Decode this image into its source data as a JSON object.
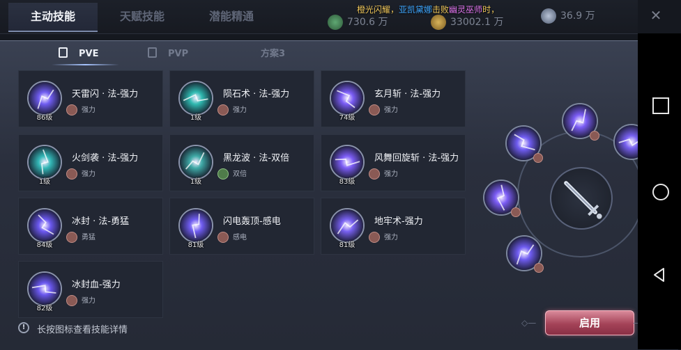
{
  "top_tabs": [
    "主动技能",
    "天赋技能",
    "潜能精通"
  ],
  "broadcast": {
    "prefix": "橙光闪耀，",
    "name1": "亚凯黛娜",
    "verb": "击败",
    "name2": "幽灵巫师",
    "suffix": "时，"
  },
  "resources": [
    {
      "icon": "jade-icon",
      "value": "730.6 万"
    },
    {
      "icon": "gold-icon",
      "value": "33002.1 万"
    },
    {
      "icon": "crystal-icon",
      "value": "36.9 万"
    }
  ],
  "sub_tabs": [
    "PVE",
    "PVP",
    "方案3"
  ],
  "skills": [
    {
      "name": "天雷闪 · 法-强力",
      "level": "86级",
      "tag": "强力",
      "tag_color": "#8a5a55",
      "icon": "lightning-skill-icon",
      "hue": "#6f5cf0"
    },
    {
      "name": "陨石术 · 法-强力",
      "level": "1级",
      "tag": "强力",
      "tag_color": "#8a5a55",
      "icon": "meteor-skill-icon",
      "hue": "#2fb9b0"
    },
    {
      "name": "玄月斩 · 法-强力",
      "level": "74级",
      "tag": "强力",
      "tag_color": "#8a5a55",
      "icon": "crescent-skill-icon",
      "hue": "#7a5cf4"
    },
    {
      "name": "火剑袭 · 法-强力",
      "level": "1级",
      "tag": "强力",
      "tag_color": "#8a5a55",
      "icon": "fire-sword-skill-icon",
      "hue": "#33b7b6"
    },
    {
      "name": "黑龙波 · 法-双倍",
      "level": "1级",
      "tag": "双倍",
      "tag_color": "#4f7c4a",
      "icon": "dragon-skill-icon",
      "hue": "#3fa9a6"
    },
    {
      "name": "风舞回旋斩 · 法-强力",
      "level": "83级",
      "tag": "强力",
      "tag_color": "#8a5a55",
      "icon": "whirlwind-skill-icon",
      "hue": "#7b5cf4"
    },
    {
      "name": "冰封 · 法-勇猛",
      "level": "84级",
      "tag": "勇猛",
      "tag_color": "#8a5a55",
      "icon": "ice-seal-skill-icon",
      "hue": "#6b58ef"
    },
    {
      "name": "闪电轰顶-感电",
      "level": "81级",
      "tag": "感电",
      "tag_color": "#8a5a55",
      "icon": "thunderstrike-skill-icon",
      "hue": "#6f5cf0"
    },
    {
      "name": "地牢术-强力",
      "level": "81级",
      "tag": "强力",
      "tag_color": "#8a5a55",
      "icon": "dungeon-skill-icon",
      "hue": "#7760ef"
    },
    {
      "name": "冰封血-强力",
      "level": "82级",
      "tag": "强力",
      "tag_color": "#8a5a55",
      "icon": "ice-blood-skill-icon",
      "hue": "#6a57ee"
    }
  ],
  "hint": "长按图标查看技能详情",
  "apply_label": "启用",
  "wheel": {
    "slots": [
      {
        "icon": "crescent-skill-icon",
        "hue": "#7a5cf4"
      },
      {
        "icon": "dungeon-skill-icon",
        "hue": "#7760ef"
      },
      {
        "icon": "lightning-skill-icon",
        "hue": "#6f5cf0"
      },
      {
        "icon": "whirlwind-skill-icon",
        "hue": "#7b5cf4"
      },
      {
        "icon": "thunderstrike-skill-icon",
        "hue": "#6f5cf0"
      }
    ],
    "center": "sword-icon"
  }
}
